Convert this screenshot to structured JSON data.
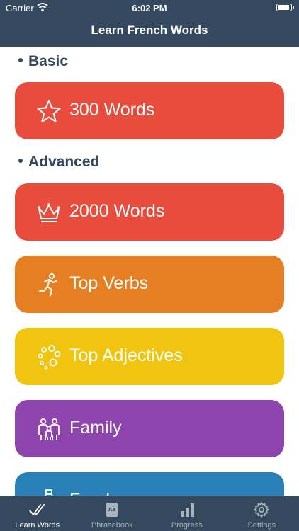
{
  "status": {
    "carrier": "Carrier",
    "time": "6:02 PM"
  },
  "header": {
    "title": "Learn French Words"
  },
  "sections": {
    "basic": "Basic",
    "advanced": "Advanced"
  },
  "cards": [
    {
      "label": "300 Words",
      "color": "#e74c3c",
      "icon": "star-icon"
    },
    {
      "label": "2000 Words",
      "color": "#e74c3c",
      "icon": "crown-icon"
    },
    {
      "label": "Top Verbs",
      "color": "#e67e22",
      "icon": "runner-icon"
    },
    {
      "label": "Top Adjectives",
      "color": "#f1c40f",
      "icon": "bubbles-icon"
    },
    {
      "label": "Family",
      "color": "#8e44ad",
      "icon": "family-icon"
    },
    {
      "label": "Food",
      "color": "#2980b9",
      "icon": "bottle-icon"
    }
  ],
  "tabs": [
    {
      "label": "Learn Words",
      "icon": "checkmarks-icon",
      "active": true
    },
    {
      "label": "Phrasebook",
      "icon": "book-icon",
      "active": false
    },
    {
      "label": "Progress",
      "icon": "bar-chart-icon",
      "active": false
    },
    {
      "label": "Settings",
      "icon": "gear-icon",
      "active": false
    }
  ],
  "colors": {
    "header": "#34495e",
    "tabbar": "#34495e",
    "section": "#34495e"
  }
}
